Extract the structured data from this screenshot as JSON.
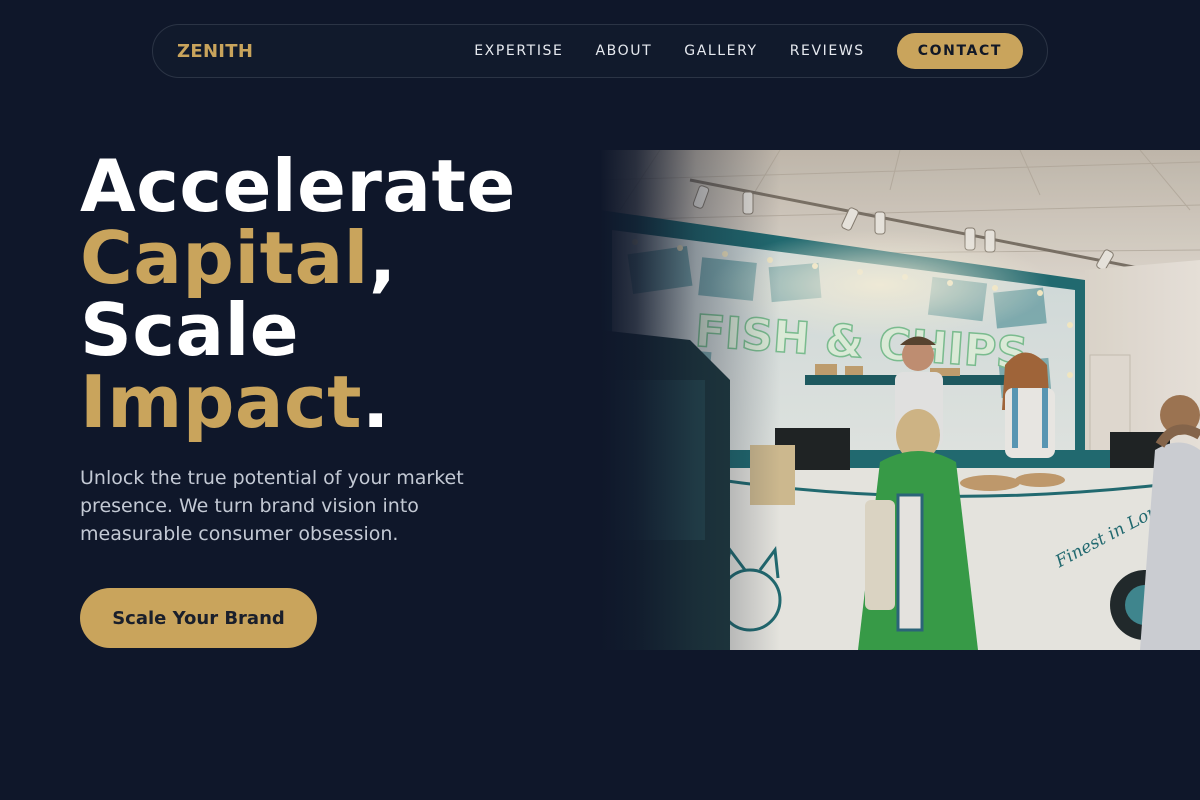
{
  "nav": {
    "logo": "ZENITH",
    "links": [
      "EXPERTISE",
      "ABOUT",
      "GALLERY",
      "REVIEWS"
    ],
    "contact_label": "CONTACT"
  },
  "hero": {
    "headline": {
      "line1": "Accelerate",
      "line2_gold": "Capital",
      "line2_white": ",",
      "line3": "Scale",
      "line4_gold": "Impact",
      "line4_white": "."
    },
    "subtext": "Unlock the true potential of your market presence. We turn brand vision into measurable consumer obsession.",
    "cta_label": "Scale Your Brand",
    "image": {
      "sign_text": "FISH & CHIPS",
      "van_text": "Finest in London!"
    }
  },
  "colors": {
    "background": "#0f172a",
    "accent_gold": "#c9a45c",
    "text_white": "#ffffff",
    "text_muted": "#c3c9d4"
  }
}
